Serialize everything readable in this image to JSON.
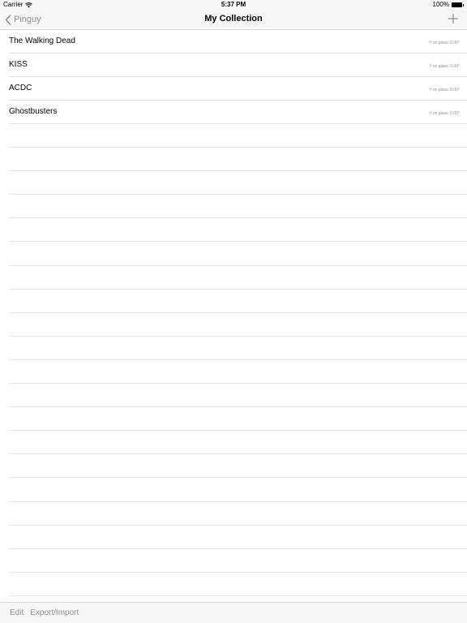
{
  "status_bar": {
    "carrier": "Carrier",
    "time": "5:37 PM",
    "battery": "100%"
  },
  "nav": {
    "back_label": "Pinguy",
    "title": "My Collection",
    "add_icon": "plus-icon"
  },
  "items": [
    {
      "title": "The Walking Dead",
      "detail": "Y on glass: 0.00°"
    },
    {
      "title": "KISS",
      "detail": "Y on glass: 0.00°"
    },
    {
      "title": "ACDC",
      "detail": "Y on glass: 0.00°"
    },
    {
      "title": "Ghostbusters",
      "detail": "Y on glass: 0.00°"
    }
  ],
  "toolbar": {
    "edit_label": "Edit",
    "export_import_label": "Export/Import"
  },
  "colors": {
    "bar_background": "#f7f7f7",
    "inactive_tint": "#8e8e93",
    "separator": "#e1e1e1"
  }
}
